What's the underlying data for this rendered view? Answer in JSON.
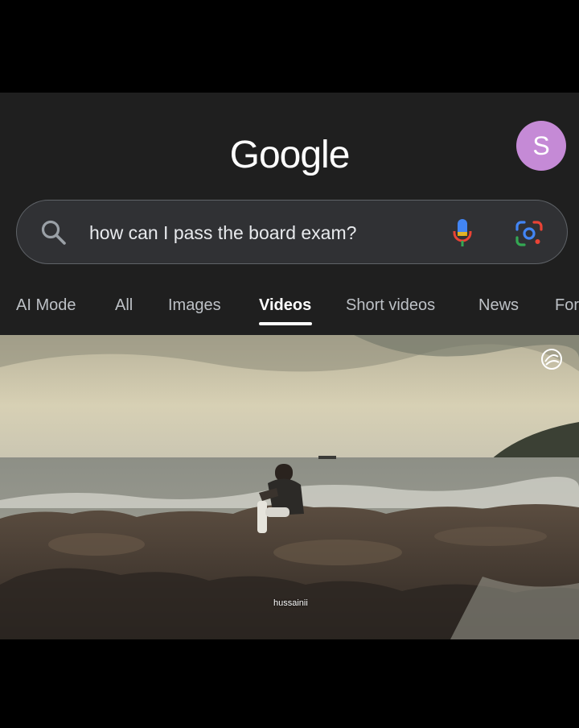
{
  "header": {
    "logo_text": "Google",
    "avatar_letter": "S"
  },
  "search": {
    "query": "how can I pass the board exam?"
  },
  "tabs": [
    {
      "label": "AI Mode",
      "active": false
    },
    {
      "label": "All",
      "active": false
    },
    {
      "label": "Images",
      "active": false
    },
    {
      "label": "Videos",
      "active": true
    },
    {
      "label": "Short videos",
      "active": false
    },
    {
      "label": "News",
      "active": false
    },
    {
      "label": "For",
      "active": false
    }
  ],
  "video": {
    "caption": "hussainii"
  },
  "icons": {
    "search": "search-icon",
    "mic": "microphone-icon",
    "lens": "google-lens-icon",
    "watermark": "watermark-logo-icon"
  },
  "colors": {
    "background": "#1f1f1f",
    "search_box": "#303134",
    "avatar": "#c58ad6",
    "active_tab": "#ffffff",
    "inactive_tab": "#bdc1c6"
  }
}
